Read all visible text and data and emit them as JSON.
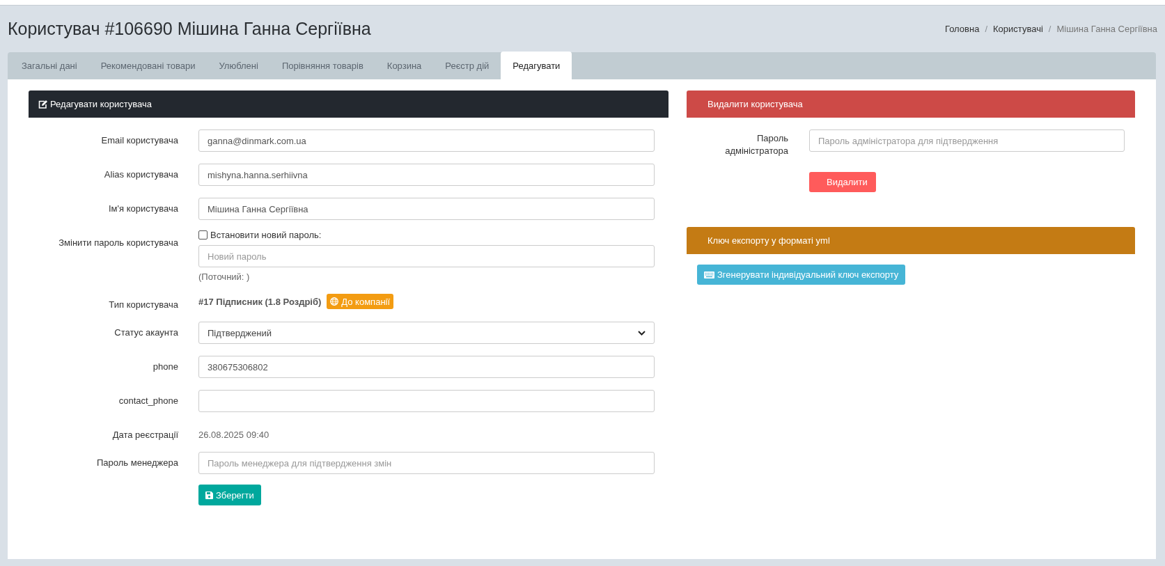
{
  "page_title": "Користувач #106690 Мішина Ганна Сергіївна",
  "breadcrumb_separator": "/",
  "breadcrumbs": [
    {
      "label": "Головна",
      "current": false
    },
    {
      "label": "Користувачі",
      "current": false
    },
    {
      "label": "Мішина Ганна Сергіївна",
      "current": true
    }
  ],
  "tabs": [
    {
      "label": "Загальні дані",
      "selected": false
    },
    {
      "label": "Рекомендовані товари",
      "selected": false
    },
    {
      "label": "Улюблені",
      "selected": false
    },
    {
      "label": "Порівняння товарів",
      "selected": false
    },
    {
      "label": "Корзина",
      "selected": false
    },
    {
      "label": "Реєстр дій",
      "selected": false
    },
    {
      "label": "Редагувати",
      "selected": true
    }
  ],
  "edit_form": {
    "title": "Редагувати користувача",
    "fields": [
      {
        "kind": "input",
        "label": "Email користувача",
        "value": "ganna@dinmark.com.ua"
      },
      {
        "kind": "input",
        "label": "Alias користувача",
        "value": "mishyna.hanna.serhiivna"
      },
      {
        "kind": "input",
        "label": "Ім'я користувача",
        "value": "Мішина Ганна Сергіївна"
      },
      {
        "kind": "password",
        "label": "Змінити пароль користувача",
        "checkbox_label": "Встановити новий пароль:",
        "checked": false,
        "placeholder": "Новий пароль",
        "note": "(Поточний: )"
      },
      {
        "kind": "type",
        "label": "Тип користувача",
        "value": "#17 Підписник (1.8 Роздріб)",
        "button": "До компанії"
      },
      {
        "kind": "select",
        "label": "Статус акаунта",
        "value": "Підтверджений"
      },
      {
        "kind": "input",
        "label": "phone",
        "value": "380675306802"
      },
      {
        "kind": "input",
        "label": "contact_phone"
      },
      {
        "kind": "text",
        "label": "Дата реєстрації",
        "value": "26.08.2025 09:40"
      },
      {
        "kind": "input",
        "label": "Пароль менеджера",
        "placeholder": "Пароль менеджера для підтвердження змін"
      }
    ],
    "save_button": "Зберегти"
  },
  "delete_panel": {
    "title": "Видалити користувача",
    "label": "Пароль адміністратора",
    "placeholder": "Пароль адміністратора для підтвердження",
    "button": "Видалити"
  },
  "export_panel": {
    "title": "Ключ експорту у форматі yml",
    "button": "Згенерувати індивідуальний ключ експорту"
  }
}
